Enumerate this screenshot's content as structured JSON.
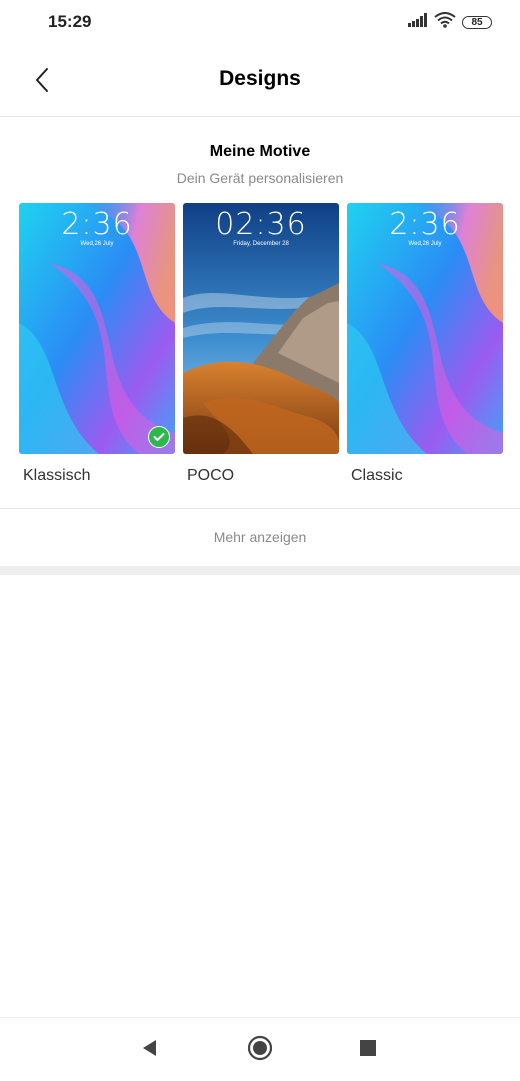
{
  "status": {
    "time": "15:29",
    "battery": "85",
    "icons": [
      "signal-icon",
      "wifi-icon",
      "battery-icon"
    ]
  },
  "header": {
    "title": "Designs",
    "back_icon": "chevron-left-icon"
  },
  "section": {
    "title": "Meine Motive",
    "subtitle": "Dein Gerät personalisieren"
  },
  "themes": [
    {
      "label": "Klassisch",
      "lock_time": "2:36",
      "lock_date": "Wed,26  July",
      "selected": true
    },
    {
      "label": "POCO",
      "lock_time": "02:36",
      "lock_date": "Friday, December 28",
      "selected": false
    },
    {
      "label": "Classic",
      "lock_time": "2:36",
      "lock_date": "Wed,26  July",
      "selected": false
    }
  ],
  "more": {
    "label": "Mehr anzeigen"
  },
  "nav": {
    "back_icon": "triangle-back-icon",
    "home_icon": "circle-home-icon",
    "recents_icon": "square-recents-icon"
  },
  "colors": {
    "accent_check": "#2db84d",
    "subtitle": "#8a8a8a"
  }
}
